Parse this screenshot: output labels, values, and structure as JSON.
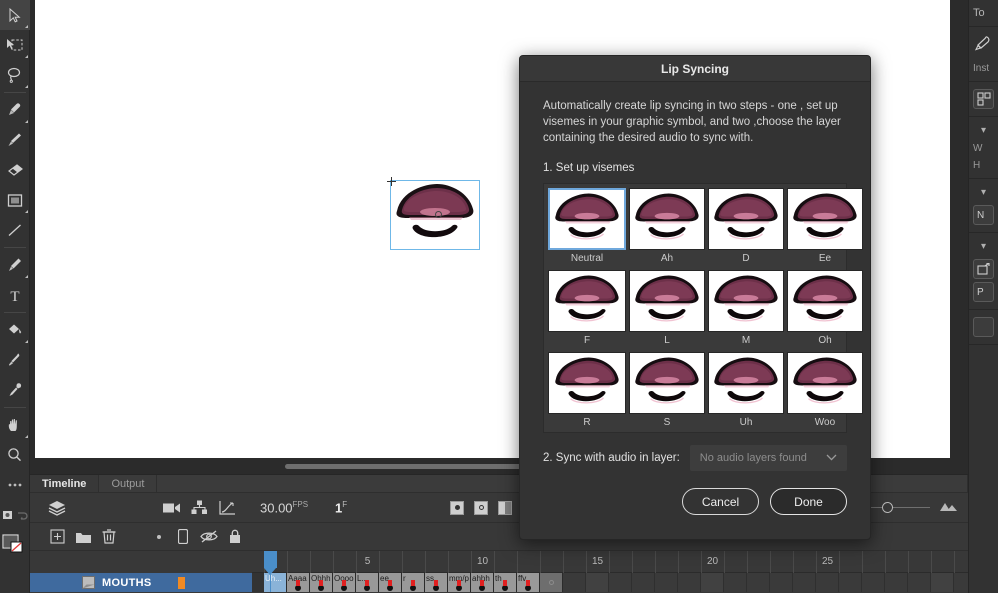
{
  "toolbar": {
    "tools": [
      {
        "name": "selection-tool",
        "icon": "arrow",
        "selected": true,
        "corner": true
      },
      {
        "name": "free-transform-tool",
        "icon": "transform",
        "selected": false,
        "corner": true
      },
      {
        "name": "lasso-tool",
        "icon": "lasso",
        "selected": false,
        "corner": true
      },
      {
        "name": "paint-brush-tool",
        "icon": "paintbrush",
        "selected": false,
        "corner": true
      },
      {
        "name": "brush-tool",
        "icon": "brush",
        "selected": false,
        "corner": false
      },
      {
        "name": "eraser-tool",
        "icon": "eraser",
        "selected": false,
        "corner": false
      },
      {
        "name": "rectangle-tool",
        "icon": "rectangle",
        "selected": false,
        "corner": true
      },
      {
        "name": "line-tool",
        "icon": "line",
        "selected": false,
        "corner": false
      },
      {
        "name": "pen-tool",
        "icon": "pen",
        "selected": false,
        "corner": true
      },
      {
        "name": "text-tool",
        "icon": "text",
        "selected": false,
        "corner": false
      },
      {
        "name": "paint-bucket-tool",
        "icon": "bucket",
        "selected": false,
        "corner": true
      },
      {
        "name": "eyedropper-tool",
        "icon": "eyedropper",
        "selected": false,
        "corner": false
      },
      {
        "name": "bone-tool",
        "icon": "pin",
        "selected": false,
        "corner": false
      },
      {
        "name": "hand-tool",
        "icon": "hand",
        "selected": false,
        "corner": true
      },
      {
        "name": "zoom-tool",
        "icon": "magnifier",
        "selected": false,
        "corner": false
      },
      {
        "name": "more-tools",
        "icon": "ellipsis",
        "selected": false,
        "corner": false
      },
      {
        "name": "camera-tool",
        "icon": "camera",
        "selected": false,
        "corner": false
      }
    ]
  },
  "right_panel": {
    "tool_title": "To",
    "instance_label": "Inst",
    "swap_label": "",
    "section_w": "W",
    "section_h": "H",
    "name_field": "N",
    "publish_label": "P"
  },
  "timeline": {
    "tabs": [
      {
        "label": "Timeline",
        "active": true
      },
      {
        "label": "Output",
        "active": false
      }
    ],
    "fps": "30.00",
    "fps_suffix": "FPS",
    "current_frame": "1",
    "frame_suffix": "F",
    "layer": {
      "name": "MOUTHS",
      "selected": true
    },
    "ruler_ticks": [
      "5",
      "10",
      "15",
      "20",
      "25"
    ],
    "frames": [
      {
        "label": "Uh...",
        "type": "current"
      },
      {
        "label": "Aaaa",
        "type": "key"
      },
      {
        "label": "Ohhh",
        "type": "key"
      },
      {
        "label": "Oooo",
        "type": "key"
      },
      {
        "label": "L...",
        "type": "key"
      },
      {
        "label": "ee",
        "type": "key"
      },
      {
        "label": "r",
        "type": "key"
      },
      {
        "label": "ss",
        "type": "key"
      },
      {
        "label": "mm/p",
        "type": "key"
      },
      {
        "label": "ahhh",
        "type": "key"
      },
      {
        "label": "th",
        "type": "key"
      },
      {
        "label": "ffv",
        "type": "key"
      },
      {
        "label": "",
        "type": "end"
      }
    ]
  },
  "dialog": {
    "title": "Lip Syncing",
    "description": "Automatically create lip syncing in two steps - one , set up visemes in your graphic symbol, and two ,choose the layer containing the desired audio to sync with.",
    "step1_label": "1. Set up visemes",
    "visemes": [
      {
        "label": "Neutral",
        "selected": true
      },
      {
        "label": "Ah",
        "selected": false
      },
      {
        "label": "D",
        "selected": false
      },
      {
        "label": "Ee",
        "selected": false
      },
      {
        "label": "F",
        "selected": false
      },
      {
        "label": "L",
        "selected": false
      },
      {
        "label": "M",
        "selected": false
      },
      {
        "label": "Oh",
        "selected": false
      },
      {
        "label": "R",
        "selected": false
      },
      {
        "label": "S",
        "selected": false
      },
      {
        "label": "Uh",
        "selected": false
      },
      {
        "label": "Woo",
        "selected": false
      }
    ],
    "step2_label": "2. Sync with audio in layer:",
    "audio_layer_value": "No audio layers found",
    "cancel_label": "Cancel",
    "done_label": "Done"
  },
  "colors": {
    "accent": "#4a8ec9",
    "selection": "#6fa8dc",
    "layer_row": "#3f6a9e",
    "lip_fill": "#6d3049",
    "keyframe": "#e02020"
  }
}
